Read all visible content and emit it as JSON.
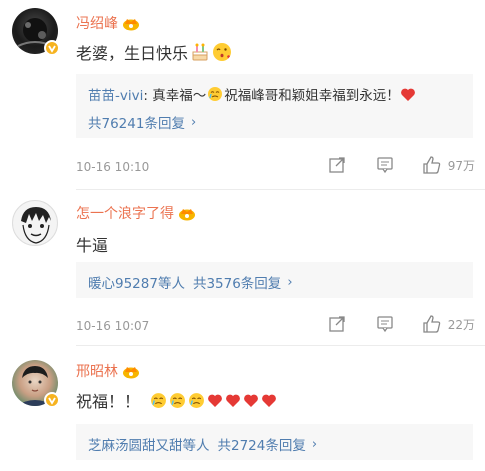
{
  "comments": [
    {
      "name": "冯绍峰",
      "text": "老婆，生日快乐",
      "reply": {
        "user": "苗苗-vivi",
        "text": ": 真幸福～",
        "text2": "祝福峰哥和颖姐幸福到永远！",
        "more": "共76241条回复"
      },
      "time": "10-16 10:10",
      "likes": "97万"
    },
    {
      "name": "怎一个浪字了得",
      "text": "牛逼",
      "reply": {
        "users": "暖心95287等人",
        "more": "共3576条回复"
      },
      "time": "10-16 10:07",
      "likes": "22万"
    },
    {
      "name": "邢昭林",
      "text": "祝福！！",
      "reply": {
        "users": "芝麻汤圆甜又甜等人",
        "more": "共2724条回复"
      }
    }
  ],
  "icons": [
    "crown-icon",
    "verified-icon",
    "share-icon",
    "comment-icon",
    "like-icon",
    "chevron-right-icon"
  ],
  "colors": {
    "name": "#eb7350",
    "link": "#507daf",
    "meta": "#999999",
    "reply_bg": "#f7f7f7"
  }
}
